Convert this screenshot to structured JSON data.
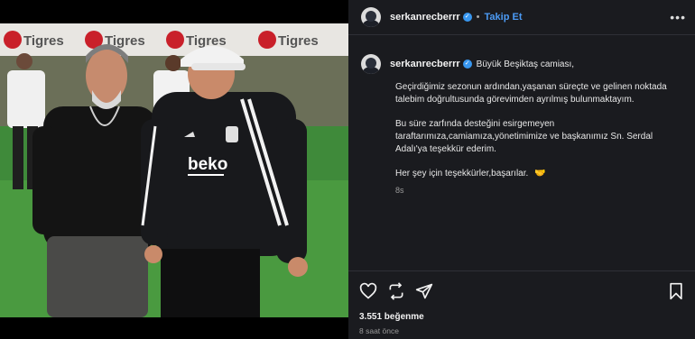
{
  "header": {
    "username": "serkanrecberrr",
    "separator": "•",
    "follow_label": "Takip Et",
    "more_label": "•••"
  },
  "caption": {
    "username": "serkanrecberrr",
    "greeting": "Büyük Beşiktaş camiası,",
    "para1_line1": "Geçirdiğimiz sezonun ardından,yaşanan süreçte ve gelinen noktada",
    "para1_line2": "talebim doğrultusunda görevimden ayrılmış bulunmaktayım.",
    "para2_line1": "Bu süre zarfında desteğini esirgemeyen",
    "para2_line2": "taraftarımıza,camiamıza,yönetimimize ve başkanımız Sn. Serdal",
    "para2_line3": "Adalı'ya teşekkür ederim.",
    "para3": "Her şey için teşekkürler,başarılar.",
    "time": "8s"
  },
  "photo": {
    "shirt_brand": "beko",
    "banner_text": [
      "Tigres",
      "Tigres",
      "Tigres",
      "Tigres"
    ]
  },
  "likes": "3.551 beğenme",
  "posted_ago": "8 saat önce",
  "icons": [
    "heart-icon",
    "repost-icon",
    "share-icon",
    "bookmark-icon"
  ]
}
